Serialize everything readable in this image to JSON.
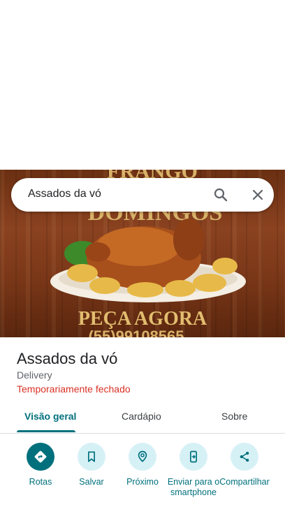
{
  "search": {
    "query": "Assados da vó"
  },
  "hero": {
    "banner_top": "FRANGO",
    "banner_mid": "DOMINGOS",
    "cta": "PEÇA AGORA",
    "phone_partial": "(55)99108565"
  },
  "place": {
    "name": "Assados da vó",
    "category": "Delivery",
    "status": "Temporariamente fechado"
  },
  "tabs": [
    {
      "label": "Visão geral"
    },
    {
      "label": "Cardápio"
    },
    {
      "label": "Sobre"
    }
  ],
  "actions": [
    {
      "label": "Rotas",
      "icon": "directions-icon"
    },
    {
      "label": "Salvar",
      "icon": "bookmark-icon"
    },
    {
      "label": "Próximo",
      "icon": "nearby-icon"
    },
    {
      "label": "Enviar para o smartphone",
      "icon": "send-to-phone-icon"
    },
    {
      "label": "Compartilhar",
      "icon": "share-icon"
    }
  ],
  "colors": {
    "accent": "#00707d",
    "accent_light": "#d6f1f6",
    "closed": "#d93025"
  }
}
